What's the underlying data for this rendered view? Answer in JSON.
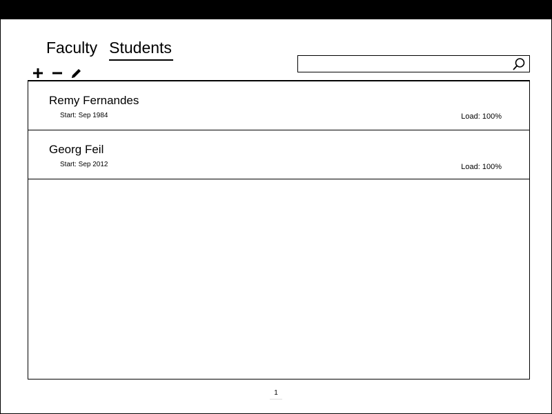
{
  "tabs": [
    {
      "label": "Faculty",
      "active": false
    },
    {
      "label": "Students",
      "active": true
    }
  ],
  "toolbar": {
    "icons": [
      "plus-icon",
      "minus-icon",
      "pencil-icon"
    ]
  },
  "search": {
    "value": "",
    "placeholder": "",
    "icon": "search-icon"
  },
  "list": {
    "items": [
      {
        "name": "Remy Fernandes",
        "start": "Start: Sep 1984",
        "load": "Load: 100%"
      },
      {
        "name": "Georg Feil",
        "start": "Start: Sep 2012",
        "load": "Load: 100%"
      }
    ]
  },
  "pagination": {
    "page": "1"
  }
}
